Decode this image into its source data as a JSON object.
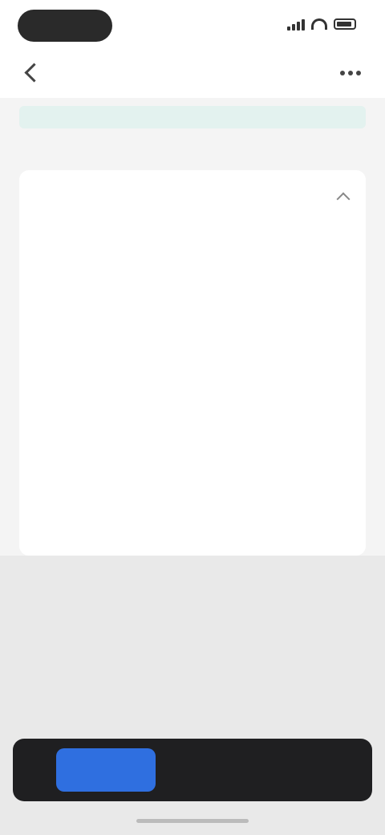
{
  "status_bar": {
    "time": "",
    "icons": [
      "signal-icon",
      "wifi-icon",
      "battery-icon"
    ]
  },
  "nav": {
    "title": "",
    "back_icon": "chevron-left-icon",
    "more_icon": "more-icon"
  },
  "notice": {
    "text": ""
  },
  "section": {
    "caption": ""
  },
  "card": {
    "title": "",
    "items": [
      {
        "label": ""
      },
      {
        "label": ""
      },
      {
        "label": ""
      },
      {
        "label": ""
      },
      {
        "label": ""
      },
      {
        "label": ""
      },
      {
        "label": ""
      },
      {
        "label": ""
      },
      {
        "label": ""
      }
    ]
  },
  "sheet": {
    "action": "",
    "hint": ""
  },
  "toast": {
    "button": "",
    "text": ""
  },
  "colors": {
    "accent": "#2f6fe0",
    "notice_bg": "#e3f2ef",
    "toast_bg": "#1f1f21"
  }
}
